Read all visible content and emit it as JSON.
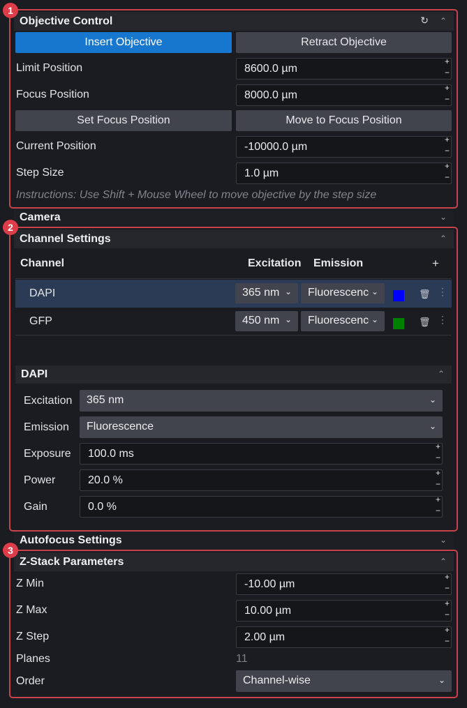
{
  "badges": [
    "1",
    "2",
    "3"
  ],
  "objective": {
    "title": "Objective Control",
    "refresh_icon": "refresh-icon",
    "collapse_icon": "chevron-up-icon",
    "insert_label": "Insert Objective",
    "retract_label": "Retract Objective",
    "limit_label": "Limit Position",
    "limit_value": "8600.0 µm",
    "focus_label": "Focus Position",
    "focus_value": "8000.0 µm",
    "set_focus_label": "Set Focus Position",
    "move_focus_label": "Move to Focus Position",
    "current_label": "Current Position",
    "current_value": "-10000.0 µm",
    "step_label": "Step Size",
    "step_value": "1.0 µm",
    "instructions": "Instructions: Use Shift + Mouse Wheel to move objective by the step size"
  },
  "camera": {
    "title": "Camera"
  },
  "channels": {
    "title": "Channel Settings",
    "headers": {
      "channel": "Channel",
      "excitation": "Excitation",
      "emission": "Emission",
      "add": "+"
    },
    "rows": [
      {
        "name": "DAPI",
        "excitation": "365 nm",
        "emission": "Fluorescence",
        "color": "#0000ff",
        "selected": true
      },
      {
        "name": "GFP",
        "excitation": "450 nm",
        "emission": "Fluorescence",
        "color": "#008000",
        "selected": false
      }
    ],
    "detail": {
      "title": "DAPI",
      "excitation_label": "Excitation",
      "excitation_value": "365 nm",
      "emission_label": "Emission",
      "emission_value": "Fluorescence",
      "exposure_label": "Exposure",
      "exposure_value": "100.0 ms",
      "power_label": "Power",
      "power_value": "20.0 %",
      "gain_label": "Gain",
      "gain_value": "0.0 %"
    }
  },
  "autofocus": {
    "title": "Autofocus Settings"
  },
  "zstack": {
    "title": "Z-Stack Parameters",
    "zmin_label": "Z Min",
    "zmin_value": "-10.00 µm",
    "zmax_label": "Z Max",
    "zmax_value": "10.00 µm",
    "zstep_label": "Z Step",
    "zstep_value": "2.00 µm",
    "planes_label": "Planes",
    "planes_value": "11",
    "order_label": "Order",
    "order_value": "Channel-wise"
  },
  "colors": {
    "accent": "#1777cf",
    "annotation": "#dc3d48"
  }
}
